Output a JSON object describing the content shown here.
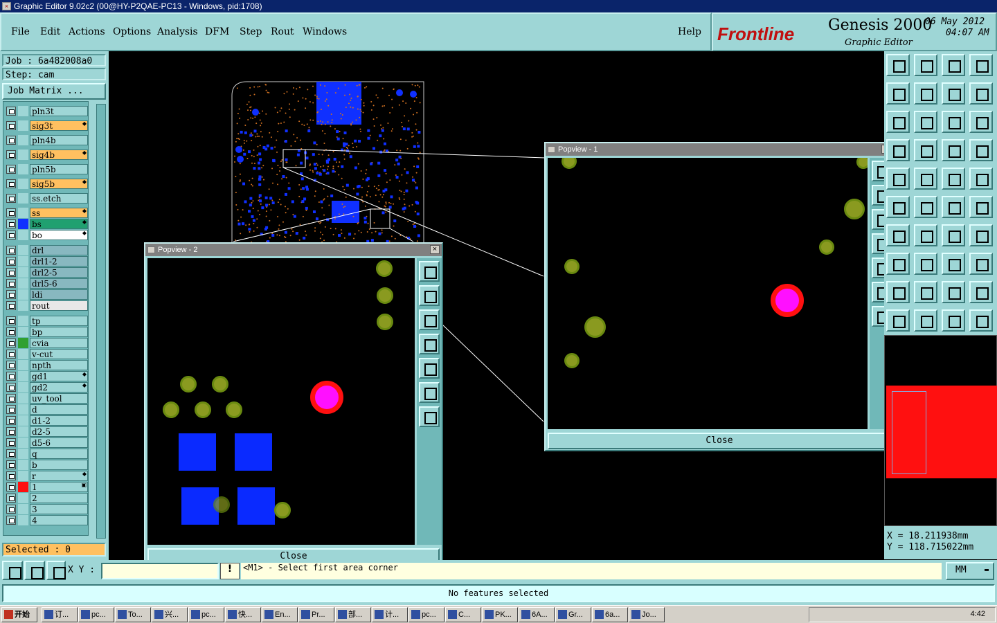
{
  "window": {
    "title": "Graphic Editor 9.02c2 (00@HY-P2QAE-PC13 - Windows, pid:1708)"
  },
  "menu": [
    "File",
    "Edit",
    "Actions",
    "Options",
    "Analysis",
    "DFM",
    "Step",
    "Rout",
    "Windows"
  ],
  "help": "Help",
  "brand": {
    "logo": "Frontline",
    "product": "Genesis 2000",
    "sub": "Graphic Editor",
    "date": "06 May 2012",
    "time": "04:07 AM"
  },
  "job": {
    "job_label": "Job  : 6a482008a0",
    "step_label": "Step: cam",
    "matrix_btn": "Job Matrix ..."
  },
  "layers": [
    {
      "name": "pln3t",
      "color": "#9ed6d6",
      "bg": "#9ed6d6",
      "mark": ""
    },
    {
      "name": "sig3t",
      "color": "#9ed6d6",
      "bg": "#ffc060",
      "mark": "◆"
    },
    {
      "name": "pln4b",
      "color": "#9ed6d6",
      "bg": "#9ed6d6",
      "mark": ""
    },
    {
      "name": "sig4b",
      "color": "#9ed6d6",
      "bg": "#ffc060",
      "mark": "◆"
    },
    {
      "name": "pln5b",
      "color": "#9ed6d6",
      "bg": "#9ed6d6",
      "mark": ""
    },
    {
      "name": "sig5b",
      "color": "#9ed6d6",
      "bg": "#ffc060",
      "mark": "◆"
    },
    {
      "name": "ss.etch",
      "color": "#9ed6d6",
      "bg": "#9ed6d6",
      "mark": ""
    },
    {
      "name": "ss",
      "color": "#9ed6d6",
      "bg": "#ffc060",
      "mark": "◆"
    },
    {
      "name": "bs",
      "color": "#1030ff",
      "bg": "#20a070",
      "mark": "◆"
    },
    {
      "name": "bo",
      "color": "#9ed6d6",
      "bg": "#ffffff",
      "mark": "◆"
    },
    {
      "name": "drl",
      "color": "#9ed6d6",
      "bg": "#88b8c0",
      "mark": ""
    },
    {
      "name": "drl1-2",
      "color": "#9ed6d6",
      "bg": "#88b8c0",
      "mark": ""
    },
    {
      "name": "drl2-5",
      "color": "#9ed6d6",
      "bg": "#88b8c0",
      "mark": ""
    },
    {
      "name": "drl5-6",
      "color": "#9ed6d6",
      "bg": "#88b8c0",
      "mark": ""
    },
    {
      "name": "ldi",
      "color": "#9ed6d6",
      "bg": "#88b8c0",
      "mark": ""
    },
    {
      "name": "rout",
      "color": "#9ed6d6",
      "bg": "#e8e8e8",
      "mark": ""
    },
    {
      "name": "tp",
      "color": "#9ed6d6",
      "bg": "#9ed6d6",
      "mark": ""
    },
    {
      "name": "bp",
      "color": "#9ed6d6",
      "bg": "#9ed6d6",
      "mark": ""
    },
    {
      "name": "cvia",
      "color": "#30a030",
      "bg": "#9ed6d6",
      "mark": ""
    },
    {
      "name": "v-cut",
      "color": "#9ed6d6",
      "bg": "#9ed6d6",
      "mark": ""
    },
    {
      "name": "npth",
      "color": "#9ed6d6",
      "bg": "#9ed6d6",
      "mark": ""
    },
    {
      "name": "gd1",
      "color": "#9ed6d6",
      "bg": "#9ed6d6",
      "mark": "◆"
    },
    {
      "name": "gd2",
      "color": "#9ed6d6",
      "bg": "#9ed6d6",
      "mark": "◆"
    },
    {
      "name": "uv_tool",
      "color": "#9ed6d6",
      "bg": "#9ed6d6",
      "mark": ""
    },
    {
      "name": "d",
      "color": "#9ed6d6",
      "bg": "#9ed6d6",
      "mark": ""
    },
    {
      "name": "d1-2",
      "color": "#9ed6d6",
      "bg": "#9ed6d6",
      "mark": ""
    },
    {
      "name": "d2-5",
      "color": "#9ed6d6",
      "bg": "#9ed6d6",
      "mark": ""
    },
    {
      "name": "d5-6",
      "color": "#9ed6d6",
      "bg": "#9ed6d6",
      "mark": ""
    },
    {
      "name": "q",
      "color": "#9ed6d6",
      "bg": "#9ed6d6",
      "mark": ""
    },
    {
      "name": "b",
      "color": "#9ed6d6",
      "bg": "#9ed6d6",
      "mark": ""
    },
    {
      "name": "r",
      "color": "#9ed6d6",
      "bg": "#9ed6d6",
      "mark": "◆"
    },
    {
      "name": "1",
      "color": "#ff1010",
      "bg": "#9ed6d6",
      "mark": "▣"
    },
    {
      "name": "2",
      "color": "#9ed6d6",
      "bg": "#9ed6d6",
      "mark": ""
    },
    {
      "name": "3",
      "color": "#9ed6d6",
      "bg": "#9ed6d6",
      "mark": ""
    },
    {
      "name": "4",
      "color": "#9ed6d6",
      "bg": "#9ed6d6",
      "mark": ""
    }
  ],
  "selected": "Selected : 0",
  "popview1": {
    "title": "Popview - 1",
    "close": "Close"
  },
  "popview2": {
    "title": "Popview - 2",
    "close": "Close"
  },
  "coords": {
    "x": "X  =  18.211938mm",
    "y": "Y  =  118.715022mm"
  },
  "command": {
    "xy_label": "X Y :",
    "xy_value": "",
    "prompt": "<M1> - Select first area corner",
    "units": "MM"
  },
  "status": "No features selected",
  "taskbar": {
    "start": "开始",
    "clock": "4:42",
    "tasks": [
      "订...",
      "pc...",
      "To...",
      "兴...",
      "pc...",
      "快...",
      "En...",
      "Pr...",
      "部...",
      "计...",
      "pc...",
      "C...",
      "PK...",
      "6A...",
      "Gr...",
      "6a...",
      "Jo..."
    ]
  }
}
